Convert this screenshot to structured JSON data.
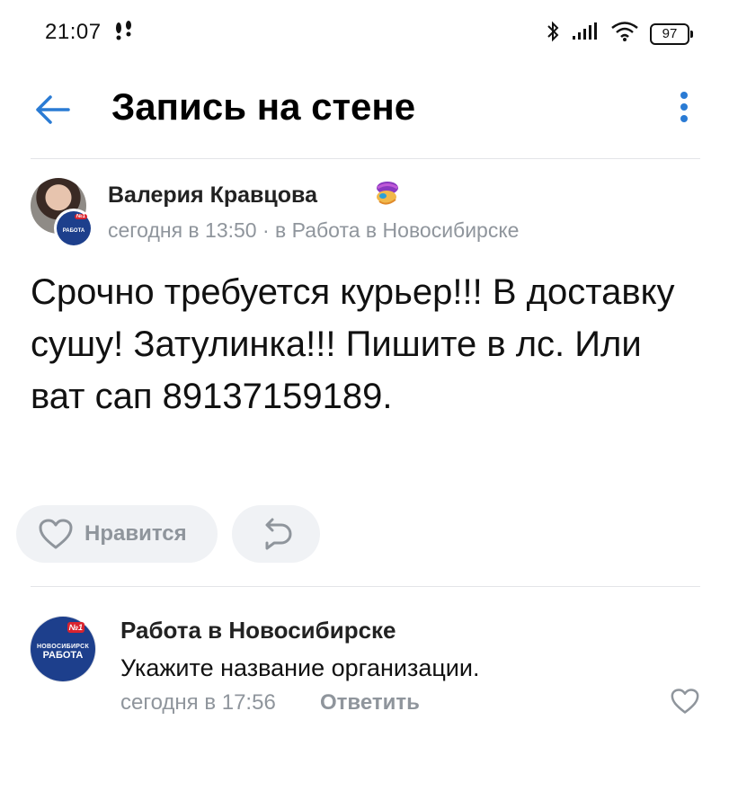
{
  "status_bar": {
    "time": "21:07",
    "battery": "97",
    "icons": [
      "steps-icon",
      "bluetooth-icon",
      "signal-icon",
      "wifi-icon",
      "battery-icon"
    ]
  },
  "header": {
    "title": "Запись на стене",
    "accent_color": "#2a7bd4"
  },
  "post": {
    "author": "Валерия Кравцова",
    "meta": "сегодня в 13:50 · в Работа в Новосибирске",
    "text": "Срочно требуется курьер!!! В доставку сушу! Затулинка!!! Пишите в лс. Или ват сап 89137159189.",
    "like_label": "Нравится"
  },
  "group_logo": {
    "city": "НОВОСИБИРСК",
    "word": "РАБОТА",
    "number": "№1"
  },
  "comment": {
    "author": "Работа в Новосибирске",
    "text": "Укажите название организации.",
    "time": "сегодня в 17:56",
    "reply_label": "Ответить"
  }
}
